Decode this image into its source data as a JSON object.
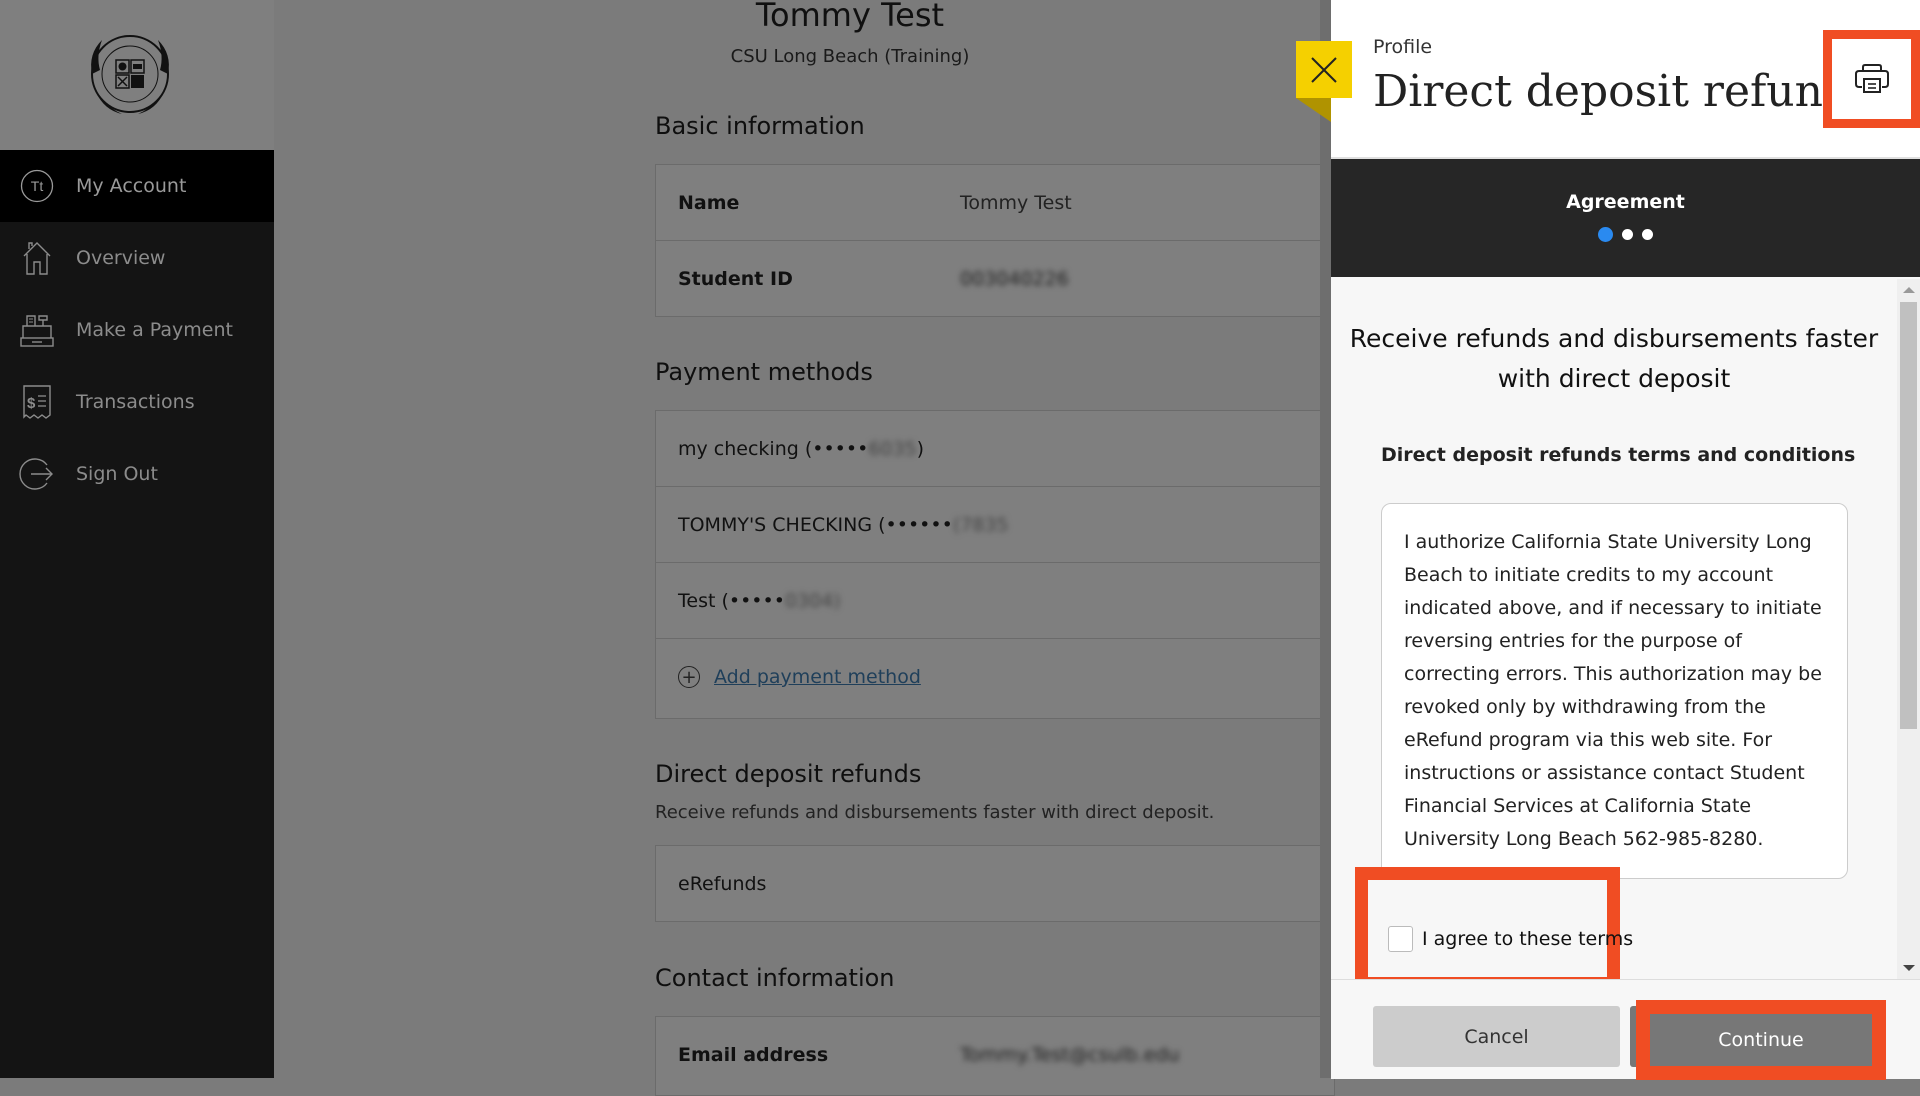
{
  "sidebar": {
    "logo_alt": "California State University Long Beach 1949 seal",
    "items": [
      {
        "label": "My Account",
        "icon": "avatar-initials-icon",
        "initials": "Tt",
        "active": true
      },
      {
        "label": "Overview",
        "icon": "home-icon",
        "active": false
      },
      {
        "label": "Make a Payment",
        "icon": "cash-register-icon",
        "active": false
      },
      {
        "label": "Transactions",
        "icon": "receipt-dollar-icon",
        "active": false
      },
      {
        "label": "Sign Out",
        "icon": "sign-out-icon",
        "active": false
      }
    ]
  },
  "profile": {
    "name": "Tommy Test",
    "institution": "CSU Long Beach (Training)",
    "basic_info": {
      "heading": "Basic information",
      "rows": [
        {
          "label": "Name",
          "value": "Tommy Test"
        },
        {
          "label": "Student ID",
          "value": "003040226"
        }
      ]
    },
    "payment_methods": {
      "heading": "Payment methods",
      "items": [
        {
          "name": "my checking (•••••",
          "masked_suffix": "6035",
          "close": ")"
        },
        {
          "name": "TOMMY'S CHECKING (••••••",
          "masked_suffix": "(7835",
          "close": ""
        },
        {
          "name": "Test (•••••",
          "masked_suffix": "0304)",
          "close": ""
        }
      ],
      "add_label": "Add payment method"
    },
    "direct_deposit": {
      "heading": "Direct deposit refunds",
      "description": "Receive refunds and disbursements faster with direct deposit.",
      "item": "eRefunds"
    },
    "contact": {
      "heading": "Contact information",
      "rows": [
        {
          "label": "Email address",
          "value": "Tommy.Test@csulb.edu"
        }
      ]
    }
  },
  "panel": {
    "breadcrumb": "Profile",
    "title": "Direct deposit refunds",
    "print_icon": "printer-icon",
    "close_icon": "close-icon",
    "step": {
      "label": "Agreement",
      "current": 1,
      "total": 3
    },
    "headline": "Receive refunds and disbursements faster with direct deposit",
    "terms_heading": "Direct deposit refunds terms and conditions",
    "terms_text": "I authorize California State University Long Beach to initiate credits to my account indicated above, and if necessary to initiate reversing entries for the purpose of correcting errors. This authorization may be revoked only by withdrawing from the eRefund program via this web site. For instructions or assistance contact Student Financial Services at California State University Long Beach 562-985-8280.",
    "agree_label": "I agree to these terms",
    "agree_checked": false,
    "cancel_label": "Cancel",
    "continue_label": "Continue"
  },
  "colors": {
    "highlight": "#f04d23",
    "close_button": "#f5d000",
    "step_active": "#2a8af0",
    "step_band": "#262626"
  }
}
